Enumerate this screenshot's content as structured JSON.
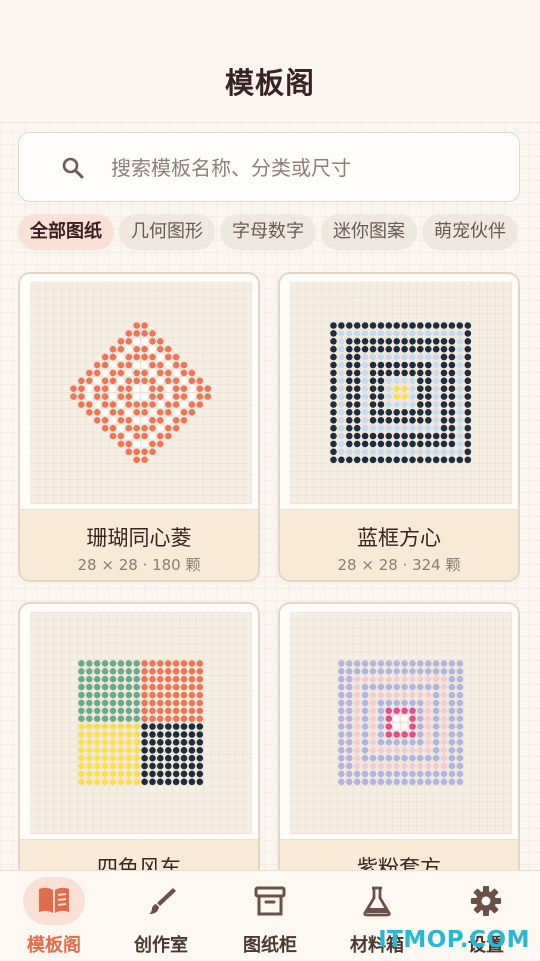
{
  "header": {
    "title": "模板阁"
  },
  "search": {
    "placeholder": "搜索模板名称、分类或尺寸",
    "value": ""
  },
  "categories": [
    "全部图纸",
    "几何图形",
    "字母数字",
    "迷你图案",
    "萌宠伙伴"
  ],
  "active_category": 0,
  "templates": [
    {
      "name": "珊瑚同心菱",
      "meta": "28 × 28 · 180 颗"
    },
    {
      "name": "蓝框方心",
      "meta": "28 × 28 · 324 颗"
    },
    {
      "name": "四色风车",
      "meta": ""
    },
    {
      "name": "紫粉套方",
      "meta": ""
    }
  ],
  "colors": {
    "coral": "#ee7556",
    "navy": "#1e2d3d",
    "light_blue": "#c6dcee",
    "yellow": "#f8dd55",
    "teal": "#6aaa8e",
    "lavender": "#b4b4e0",
    "pink_light": "#f2ccd2",
    "pink": "#e54d91",
    "accent": "#e56a4a"
  },
  "nav": [
    {
      "label": "模板阁",
      "icon": "book-icon",
      "active": true
    },
    {
      "label": "创作室",
      "icon": "brush-icon",
      "active": false
    },
    {
      "label": "图纸柜",
      "icon": "archive-icon",
      "active": false
    },
    {
      "label": "材料箱",
      "icon": "flask-icon",
      "active": false
    },
    {
      "label": "设置",
      "icon": "gear-icon",
      "active": false
    }
  ],
  "watermark": "ITMOP.COM"
}
